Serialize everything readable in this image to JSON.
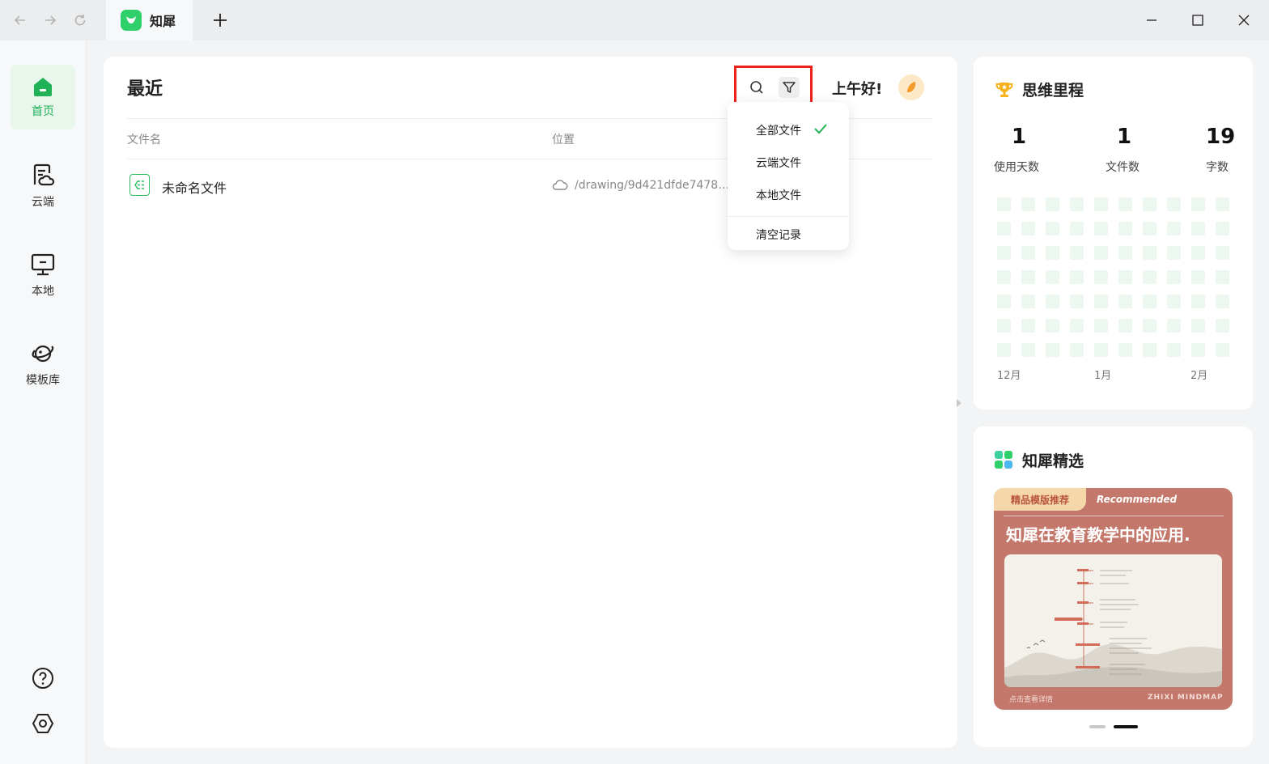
{
  "tab": {
    "title": "知犀"
  },
  "sidebar": {
    "items": [
      {
        "label": "首页",
        "icon": "home-icon"
      },
      {
        "label": "云端",
        "icon": "cloud-doc-icon"
      },
      {
        "label": "本地",
        "icon": "monitor-icon"
      },
      {
        "label": "模板库",
        "icon": "planet-icon"
      }
    ],
    "bottom": [
      {
        "icon": "help-icon"
      },
      {
        "icon": "settings-icon"
      }
    ]
  },
  "main": {
    "title": "最近",
    "greeting": "上午好!",
    "columns": {
      "name": "文件名",
      "location": "位置"
    },
    "files": [
      {
        "name": "未命名文件",
        "path": "/drawing/9d421dfde7478a…"
      }
    ]
  },
  "filter_menu": {
    "items": [
      "全部文件",
      "云端文件",
      "本地文件"
    ],
    "selected": "全部文件",
    "clear": "清空记录"
  },
  "stats": {
    "title": "思维里程",
    "days": {
      "value": "1",
      "label": "使用天数"
    },
    "files": {
      "value": "1",
      "label": "文件数"
    },
    "words": {
      "value": "19",
      "label": "字数"
    },
    "months": [
      "12月",
      "1月",
      "2月"
    ]
  },
  "featured": {
    "title": "知犀精选",
    "tag": "精品模版推荐",
    "recommended": "Recommended",
    "banner_title": "知犀在教育教学中的应用.",
    "footer_left": "点击查看详情",
    "footer_right": "ZHIXI MINDMAP",
    "carousel": {
      "count": 2,
      "active": 2
    }
  },
  "colors": {
    "accent": "#2fcf6a",
    "highlight_box": "#f0221b",
    "banner_bg": "#c3786b",
    "tag_bg": "#f6d7a9"
  }
}
